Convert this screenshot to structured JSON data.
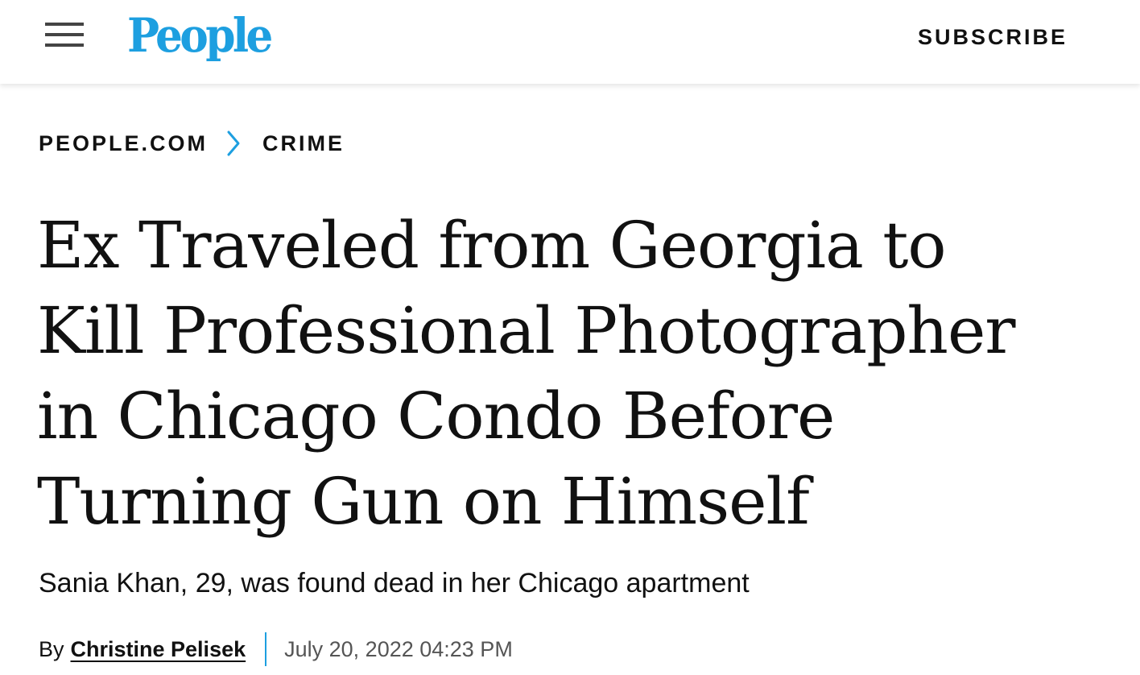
{
  "header": {
    "menu_icon": "hamburger-menu-icon",
    "logo_text": "People",
    "subscribe_label": "SUBSCRIBE"
  },
  "breadcrumb": {
    "items": [
      {
        "label": "PEOPLE.COM"
      },
      {
        "label": "CRIME"
      }
    ],
    "separator_icon": "chevron-right-icon"
  },
  "article": {
    "headline_lines": [
      "Ex Traveled from Georgia to",
      "Kill Professional Photographer",
      "in Chicago Condo Before",
      "Turning Gun on Himself"
    ],
    "subheadline": "Sania Khan, 29, was found dead in her Chicago apartment",
    "byline": {
      "prefix": "By",
      "author": "Christine Pelisek",
      "date": "July 20, 2022 04:23 PM"
    }
  },
  "colors": {
    "brand_blue": "#1d9fe0",
    "text": "#111111",
    "menu_icon": "#444444",
    "muted_text": "#555555",
    "background": "#ffffff"
  }
}
